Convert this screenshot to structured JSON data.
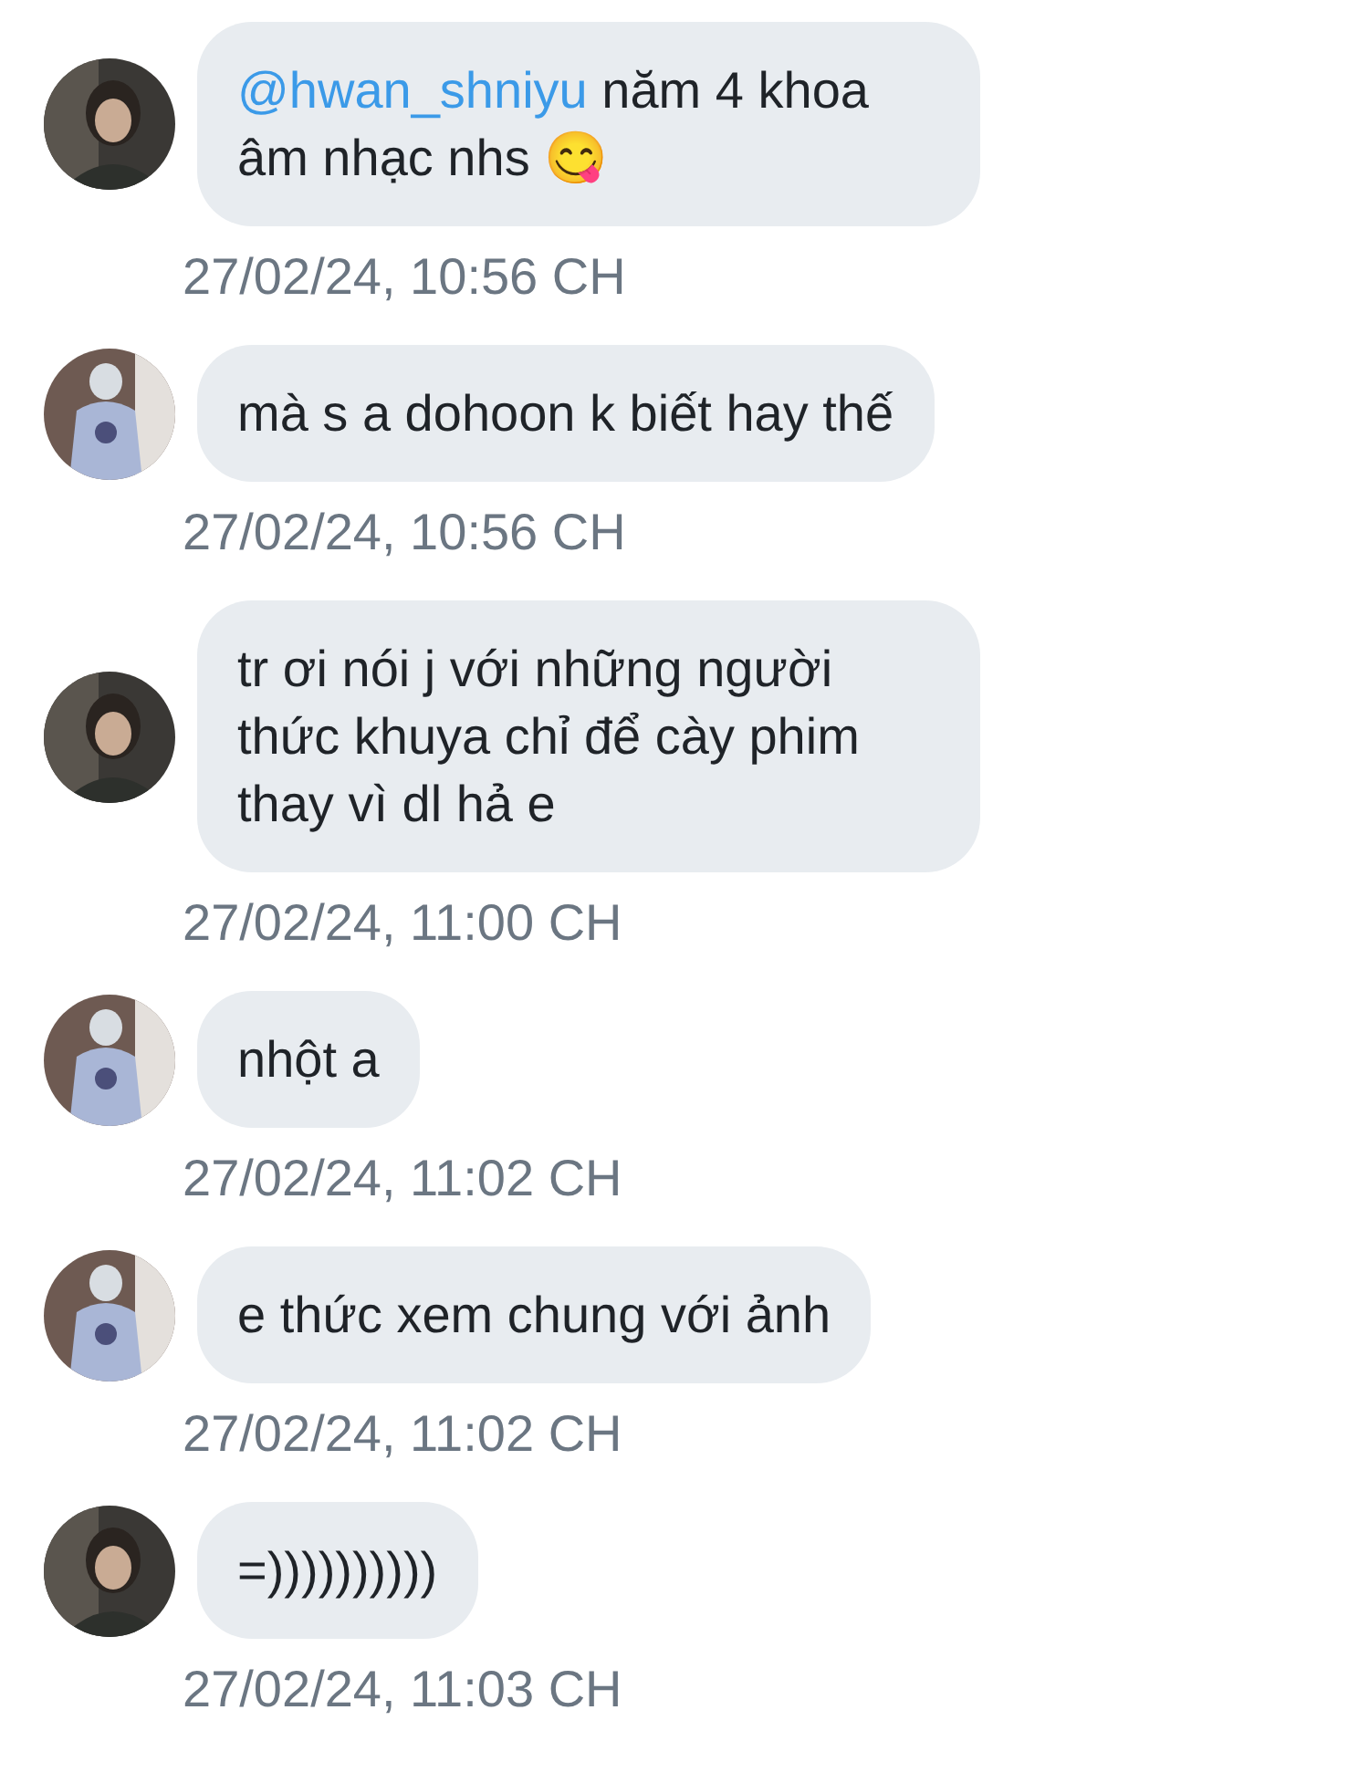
{
  "messages": [
    {
      "kind": "dark",
      "mention": "@hwan_shniyu",
      "text": " năm 4 khoa âm nhạc nhs 😋",
      "time": "27/02/24, 10:56 CH"
    },
    {
      "kind": "light",
      "text": "mà s a dohoon k biết hay thế",
      "time": "27/02/24, 10:56 CH"
    },
    {
      "kind": "dark",
      "text": "tr ơi nói j với những người thức khuya chỉ để cày phim thay vì dl hả e",
      "time": "27/02/24, 11:00 CH"
    },
    {
      "kind": "light",
      "text": "nhột a",
      "time": "27/02/24, 11:02 CH"
    },
    {
      "kind": "light",
      "text": "e thức xem chung với ảnh",
      "time": "27/02/24, 11:02 CH"
    },
    {
      "kind": "dark",
      "text": "=))))))))))",
      "time": "27/02/24, 11:03 CH"
    }
  ]
}
